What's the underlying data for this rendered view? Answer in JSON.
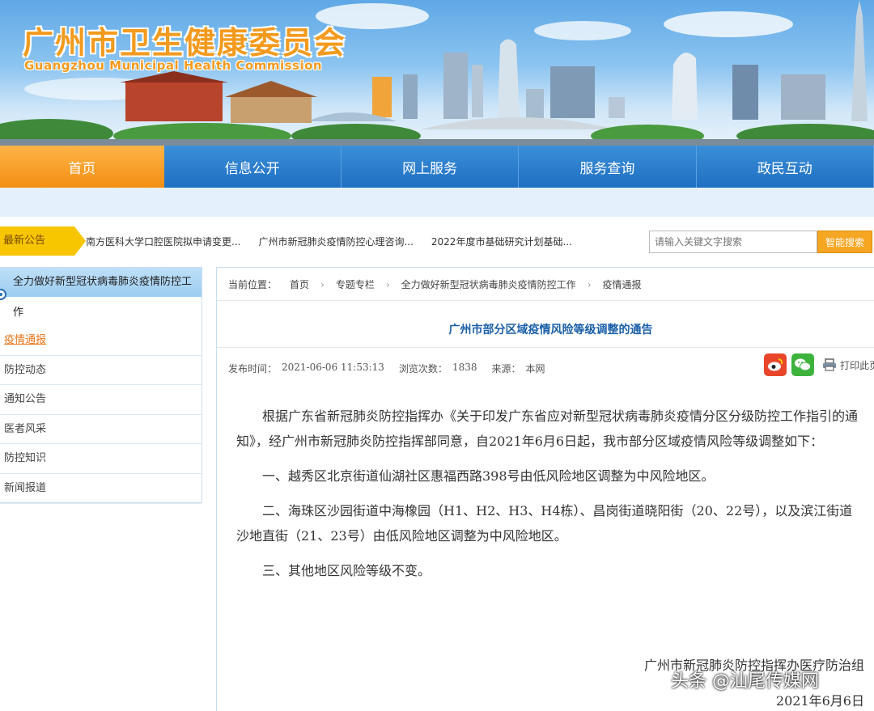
{
  "header": {
    "title": "广州市卫生健康委员会",
    "subtitle": "Guangzhou Municipal Health Commission"
  },
  "nav": {
    "items": [
      {
        "label": "首页",
        "active": true
      },
      {
        "label": "信息公开"
      },
      {
        "label": "网上服务"
      },
      {
        "label": "服务查询"
      },
      {
        "label": "政民互动"
      }
    ]
  },
  "notice": {
    "label": "最新公告",
    "items": [
      "南方医科大学口腔医院拟申请变更...",
      "广州市新冠肺炎疫情防控心理咨询...",
      "2022年度市基础研究计划基础..."
    ],
    "search_placeholder": "请输入关键文字搜索",
    "search_button": "智能搜索"
  },
  "sidebar": {
    "title_line1": "全力做好新型冠状病毒肺炎疫情防控工",
    "title_line2": "作",
    "items": [
      {
        "label": "疫情通报",
        "active": true
      },
      {
        "label": "防控动态"
      },
      {
        "label": "通知公告"
      },
      {
        "label": "医者风采"
      },
      {
        "label": "防控知识"
      },
      {
        "label": "新闻报道"
      }
    ]
  },
  "breadcrumb": {
    "label": "当前位置：",
    "items": [
      "首页",
      "专题专栏",
      "全力做好新型冠状病毒肺炎疫情防控工作",
      "疫情通报"
    ]
  },
  "article": {
    "title": "广州市部分区域疫情风险等级调整的通告",
    "meta": {
      "publish_label": "发布时间：",
      "publish_time": "2021-06-06 11:53:13",
      "views_label": "浏览次数：",
      "views": "1838",
      "source_label": "来源：",
      "source": "本网"
    },
    "print_label": "打印此页",
    "paragraphs": [
      "根据广东省新冠肺炎防控指挥办《关于印发广东省应对新型冠状病毒肺炎疫情分区分级防控工作指引的通知》，经广州市新冠肺炎防控指挥部同意，自2021年6月6日起，我市部分区域疫情风险等级调整如下：",
      "一、越秀区北京街道仙湖社区惠福西路398号由低风险地区调整为中风险地区。",
      "二、海珠区沙园街道中海橡园（H1、H2、H3、H4栋）、昌岗街道晓阳街（20、22号），以及滨江街道沙地直街（21、23号）由低风险地区调整为中风险地区。",
      "三、其他地区风险等级不变。"
    ],
    "signature": "广州市新冠肺炎防控指挥办医疗防治组",
    "date": "2021年6月6日"
  },
  "watermark": "头条 @汕尾传媒网",
  "colors": {
    "nav_blue": "#1f6fc2",
    "nav_active": "#f28f14",
    "title_orange": "#f39a1e",
    "article_title_blue": "#1a5fa8",
    "notice_yellow": "#f7c600"
  }
}
